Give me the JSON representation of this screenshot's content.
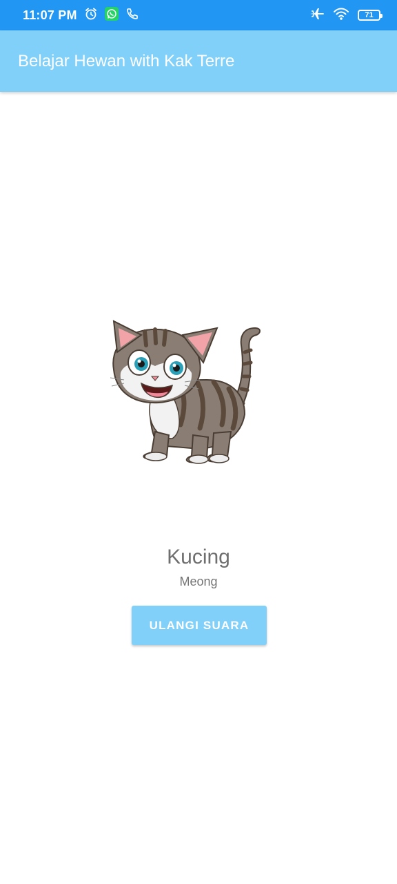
{
  "status_bar": {
    "time": "11:07 PM",
    "battery": "71",
    "icons": [
      "alarm-icon",
      "whatsapp-icon",
      "phone-icon",
      "airplane-mode-icon",
      "wifi-icon",
      "battery-icon"
    ]
  },
  "app_bar": {
    "title": "Belajar Hewan with Kak Terre"
  },
  "animal": {
    "image": "cat-illustration",
    "name": "Kucing",
    "sound": "Meong"
  },
  "actions": {
    "repeat_label": "ULANGI SUARA"
  },
  "colors": {
    "status_bar": "#2196F3",
    "accent": "#81D0FA",
    "text_primary": "#6f6f6f"
  }
}
